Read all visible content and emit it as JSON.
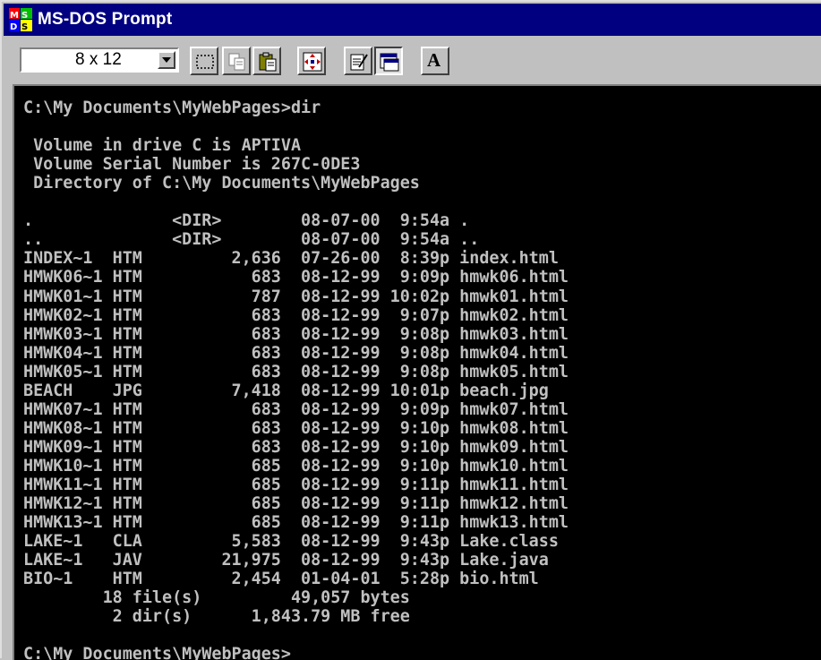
{
  "window": {
    "title": "MS-DOS Prompt"
  },
  "toolbar": {
    "font_size_value": "8 x 12",
    "buttons": [
      {
        "name": "mark-button",
        "icon": "mark-icon"
      },
      {
        "name": "copy-button",
        "icon": "copy-icon"
      },
      {
        "name": "paste-button",
        "icon": "paste-icon"
      },
      {
        "name": "fullscreen-button",
        "icon": "fullscreen-icon"
      },
      {
        "name": "properties-button",
        "icon": "properties-icon"
      },
      {
        "name": "background-button",
        "icon": "background-icon"
      },
      {
        "name": "font-button",
        "icon": "font-icon",
        "label": "A"
      }
    ]
  },
  "console": {
    "lines": [
      "C:\\My Documents\\MyWebPages>dir",
      "",
      " Volume in drive C is APTIVA",
      " Volume Serial Number is 267C-0DE3",
      " Directory of C:\\My Documents\\MyWebPages",
      "",
      ".              <DIR>        08-07-00  9:54a .",
      "..             <DIR>        08-07-00  9:54a ..",
      "INDEX~1  HTM         2,636  07-26-00  8:39p index.html",
      "HMWK06~1 HTM           683  08-12-99  9:09p hmwk06.html",
      "HMWK01~1 HTM           787  08-12-99 10:02p hmwk01.html",
      "HMWK02~1 HTM           683  08-12-99  9:07p hmwk02.html",
      "HMWK03~1 HTM           683  08-12-99  9:08p hmwk03.html",
      "HMWK04~1 HTM           683  08-12-99  9:08p hmwk04.html",
      "HMWK05~1 HTM           683  08-12-99  9:08p hmwk05.html",
      "BEACH    JPG         7,418  08-12-99 10:01p beach.jpg",
      "HMWK07~1 HTM           683  08-12-99  9:09p hmwk07.html",
      "HMWK08~1 HTM           683  08-12-99  9:10p hmwk08.html",
      "HMWK09~1 HTM           683  08-12-99  9:10p hmwk09.html",
      "HMWK10~1 HTM           685  08-12-99  9:10p hmwk10.html",
      "HMWK11~1 HTM           685  08-12-99  9:11p hmwk11.html",
      "HMWK12~1 HTM           685  08-12-99  9:11p hmwk12.html",
      "HMWK13~1 HTM           685  08-12-99  9:11p hmwk13.html",
      "LAKE~1   CLA         5,583  08-12-99  9:43p Lake.class",
      "LAKE~1   JAV        21,975  08-12-99  9:43p Lake.java",
      "BIO~1    HTM         2,454  01-04-01  5:28p bio.html",
      "        18 file(s)         49,057 bytes",
      "         2 dir(s)      1,843.79 MB free",
      "",
      "C:\\My Documents\\MyWebPages>"
    ]
  }
}
